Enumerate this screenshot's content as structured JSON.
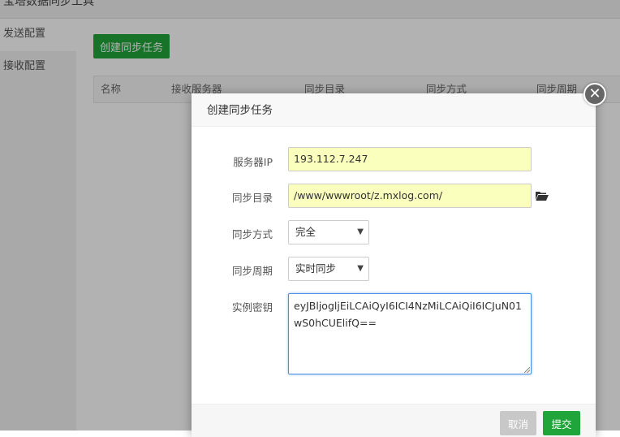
{
  "app": {
    "title": "宝塔数据同步工具"
  },
  "sidebar": {
    "items": [
      {
        "label": "发送配置",
        "active": true
      },
      {
        "label": "接收配置",
        "active": false
      }
    ]
  },
  "main": {
    "create_button": "创建同步任务",
    "table": {
      "headers": [
        "名称",
        "接收服务器",
        "同步目录",
        "同步方式",
        "同步周期"
      ]
    }
  },
  "dialog": {
    "title": "创建同步任务",
    "close_glyph": "✕",
    "fields": {
      "server_ip": {
        "label": "服务器IP",
        "value": "193.112.7.247"
      },
      "sync_dir": {
        "label": "同步目录",
        "value": "/www/wwwroot/z.mxlog.com/"
      },
      "sync_mode": {
        "label": "同步方式",
        "value": "完全"
      },
      "sync_period": {
        "label": "同步周期",
        "value": "实时同步"
      },
      "instance_key": {
        "label": "实例密钥",
        "value": "eyJBljogljEiLCAiQyI6ICI4NzMiLCAiQiI6ICJuN01wS0hCUElifQ=="
      }
    },
    "cancel_label": "取消",
    "submit_label": "提交"
  },
  "colors": {
    "primary": "#20a53a",
    "autofill": "#faffbd",
    "focus": "#4a90e2"
  }
}
